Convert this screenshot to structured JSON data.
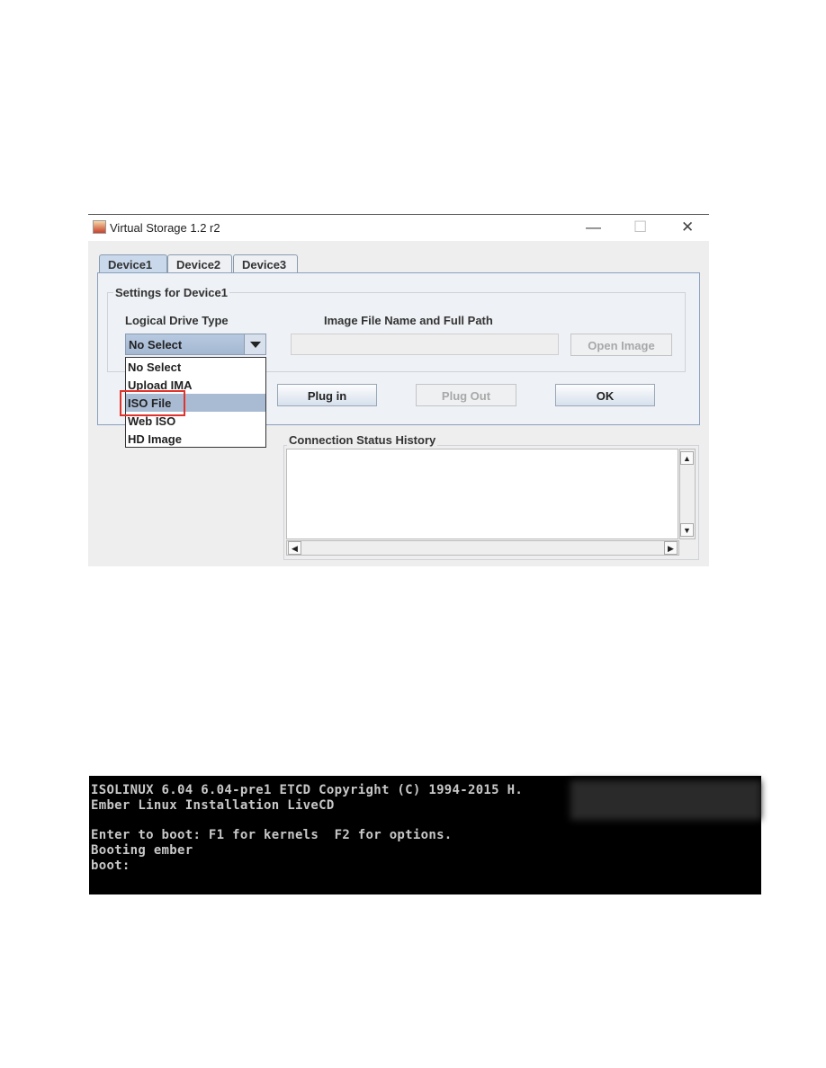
{
  "window": {
    "title": "Virtual Storage 1.2 r2",
    "controls": {
      "minimize": "—",
      "maximize": "☐",
      "close": "✕"
    }
  },
  "tabs": [
    {
      "label": "Device1",
      "active": true
    },
    {
      "label": "Device2"
    },
    {
      "label": "Device3"
    }
  ],
  "settings": {
    "group_label": "Settings for Device1",
    "drive_type_label": "Logical Drive Type",
    "image_path_label": "Image File Name and Full Path",
    "drive_type_value": "No Select",
    "image_path_value": "",
    "open_image_label": "Open Image",
    "dropdown_options": [
      "No Select",
      "Upload IMA",
      "ISO File",
      "Web ISO",
      "HD Image"
    ],
    "highlighted_option": "ISO File"
  },
  "buttons": {
    "plug_in": "Plug in",
    "plug_out": "Plug Out",
    "ok": "OK"
  },
  "status": {
    "group_label": "Connection Status History"
  },
  "colors": {
    "highlight_box": "#e0332b",
    "selection": "#a9bbd3"
  },
  "terminal": {
    "lines": [
      "ISOLINUX 6.04 6.04-pre1 ETCD Copyright (C) 1994-2015 H.",
      "Ember Linux Installation LiveCD",
      "",
      "Enter to boot: F1 for kernels  F2 for options.",
      "Booting ember",
      "boot:"
    ]
  }
}
